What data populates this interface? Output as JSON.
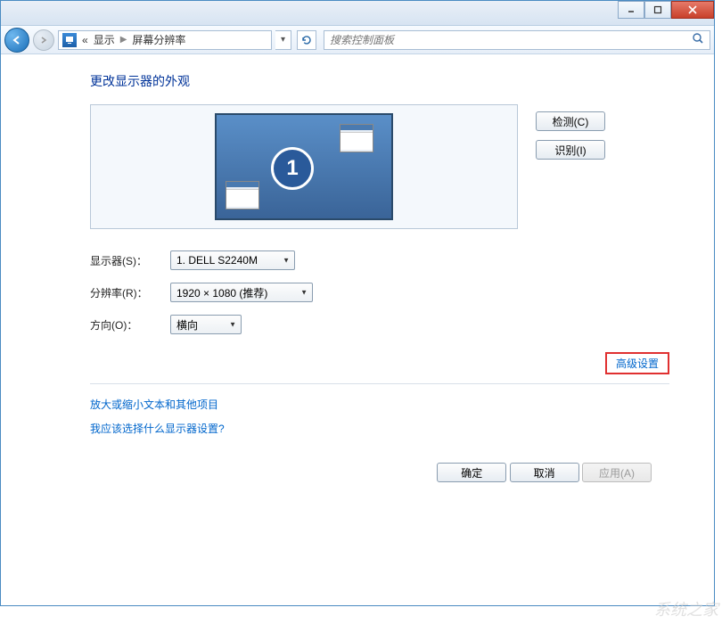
{
  "breadcrumb": {
    "level1": "显示",
    "level2": "屏幕分辨率",
    "chevron": "«"
  },
  "search": {
    "placeholder": "搜索控制面板"
  },
  "heading": "更改显示器的外观",
  "monitor_number": "1",
  "side_buttons": {
    "detect": "检测(C)",
    "identify": "识别(I)"
  },
  "form": {
    "display_label": "显示器(S)：",
    "display_value": "1. DELL S2240M",
    "resolution_label": "分辨率(R)：",
    "resolution_value": "1920 × 1080 (推荐)",
    "orientation_label": "方向(O)：",
    "orientation_value": "横向"
  },
  "advanced_link": "高级设置",
  "links": {
    "text_size": "放大或缩小文本和其他项目",
    "which_settings": "我应该选择什么显示器设置?"
  },
  "buttons": {
    "ok": "确定",
    "cancel": "取消",
    "apply": "应用(A)"
  },
  "watermark": "系统之家"
}
